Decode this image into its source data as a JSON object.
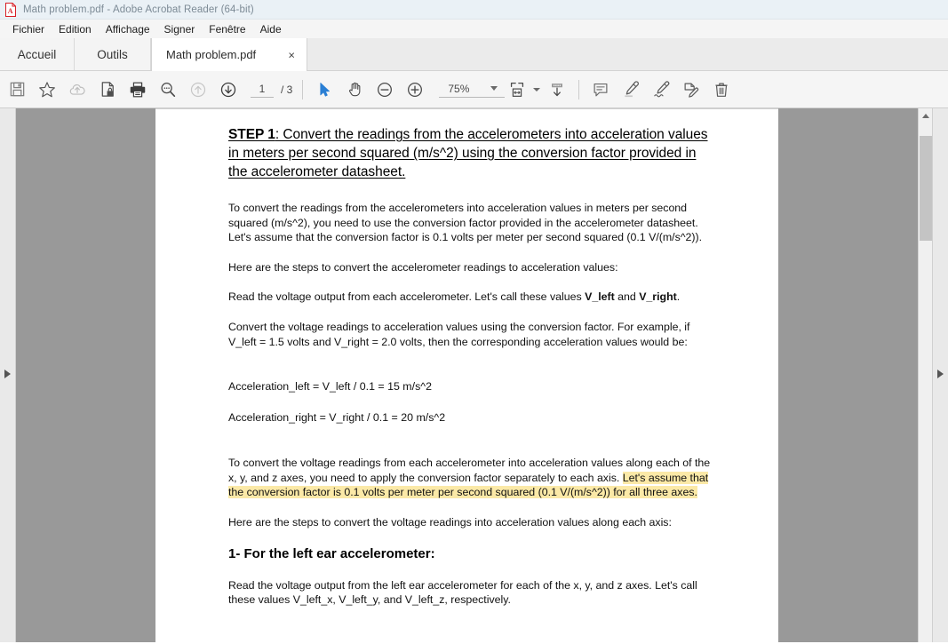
{
  "window": {
    "title": "Math problem.pdf - Adobe Acrobat Reader (64-bit)",
    "app_icon": "pdf-document-icon",
    "accent_color": "#d81f26",
    "titlebar_bg": "#eaf1f6"
  },
  "menubar": {
    "items": [
      {
        "label": "Fichier"
      },
      {
        "label": "Edition"
      },
      {
        "label": "Affichage"
      },
      {
        "label": "Signer"
      },
      {
        "label": "Fenêtre"
      },
      {
        "label": "Aide"
      }
    ]
  },
  "tabs": {
    "home_label": "Accueil",
    "tools_label": "Outils",
    "document_label": "Math problem.pdf",
    "close_glyph": "×"
  },
  "toolbar": {
    "buttons": [
      {
        "name": "save-icon",
        "title": "Enregistrer"
      },
      {
        "name": "star-icon",
        "title": "Ajouter aux favoris"
      },
      {
        "name": "cloud-upload-icon",
        "title": "Envoyer vers le cloud"
      },
      {
        "name": "protect-document-icon",
        "title": "Protéger"
      },
      {
        "name": "print-icon",
        "title": "Imprimer"
      },
      {
        "name": "search-icon",
        "title": "Rechercher"
      },
      {
        "name": "previous-page-icon",
        "title": "Page précédente"
      },
      {
        "name": "next-page-icon",
        "title": "Page suivante"
      }
    ],
    "page": {
      "current": "1",
      "separator": "/ 3",
      "total": "3"
    },
    "tools": [
      {
        "name": "select-cursor-icon",
        "title": "Sélection",
        "active": true
      },
      {
        "name": "hand-tool-icon",
        "title": "Main"
      },
      {
        "name": "zoom-out-icon",
        "title": "Zoom arrière"
      },
      {
        "name": "zoom-in-icon",
        "title": "Zoom avant"
      }
    ],
    "zoom": {
      "value": "75%",
      "caret": "chevron-down-icon"
    },
    "view_tools": [
      {
        "name": "fit-width-icon",
        "title": "Largeur de page"
      },
      {
        "name": "scroll-down-icon",
        "title": "Défilement"
      }
    ],
    "annotation_tools": [
      {
        "name": "comment-icon",
        "title": "Commentaire"
      },
      {
        "name": "highlighter-icon",
        "title": "Surligner"
      },
      {
        "name": "signature-icon",
        "title": "Signature"
      },
      {
        "name": "edit-page-icon",
        "title": "Modifier la page"
      },
      {
        "name": "delete-icon",
        "title": "Supprimer"
      }
    ]
  },
  "panels": {
    "left_arrow": "expand-left-panel-icon",
    "right_arrow": "expand-right-panel-icon"
  },
  "scrollbar": {
    "up_arrow": "scroll-up-icon"
  },
  "document": {
    "heading_bold": "STEP 1",
    "heading_rest": ": Convert the readings from the accelerometers into acceleration values in meters per second squared (m/s^2) using the conversion factor provided in the accelerometer datasheet. ",
    "paragraph_1": "To convert the readings from the accelerometers into acceleration values in meters per second squared (m/s^2), you need to use the conversion factor provided in the accelerometer datasheet. Let's assume that the conversion factor is 0.1 volts per meter per second squared (0.1 V/(m/s^2)).",
    "paragraph_2": "Here are the steps to convert the accelerometer readings to acceleration values:",
    "paragraph_3_a": "Read the voltage output from each accelerometer. Let's call these values ",
    "paragraph_3_b1": "V_left",
    "paragraph_3_c": " and ",
    "paragraph_3_b2": "V_right",
    "paragraph_3_d": ".",
    "paragraph_4": "Convert the voltage readings to acceleration values using the conversion factor. For example, if V_left = 1.5 volts and V_right = 2.0 volts, then the corresponding acceleration values would be:",
    "equation_1": "Acceleration_left = V_left / 0.1 = 15 m/s^2",
    "equation_2": "Acceleration_right = V_right / 0.1 = 20 m/s^2",
    "paragraph_5_plain": " To convert the voltage readings from each accelerometer into acceleration values along each of the x, y, and z axes, you need to apply the conversion factor separately to each axis. ",
    "paragraph_5_highlight": "Let's assume that the conversion factor is 0.1 volts per meter per second squared (0.1 V/(m/s^2)) for all three axes.",
    "paragraph_6": "Here are the steps to convert the voltage readings into acceleration values along each axis:",
    "subheading_1": "1- For the left ear accelerometer:",
    "paragraph_7": "Read the voltage output from the left ear accelerometer for each of the x, y, and z axes. Let's call these values V_left_x, V_left_y, and V_left_z, respectively.",
    "highlight_color": "#fbe9a7"
  }
}
